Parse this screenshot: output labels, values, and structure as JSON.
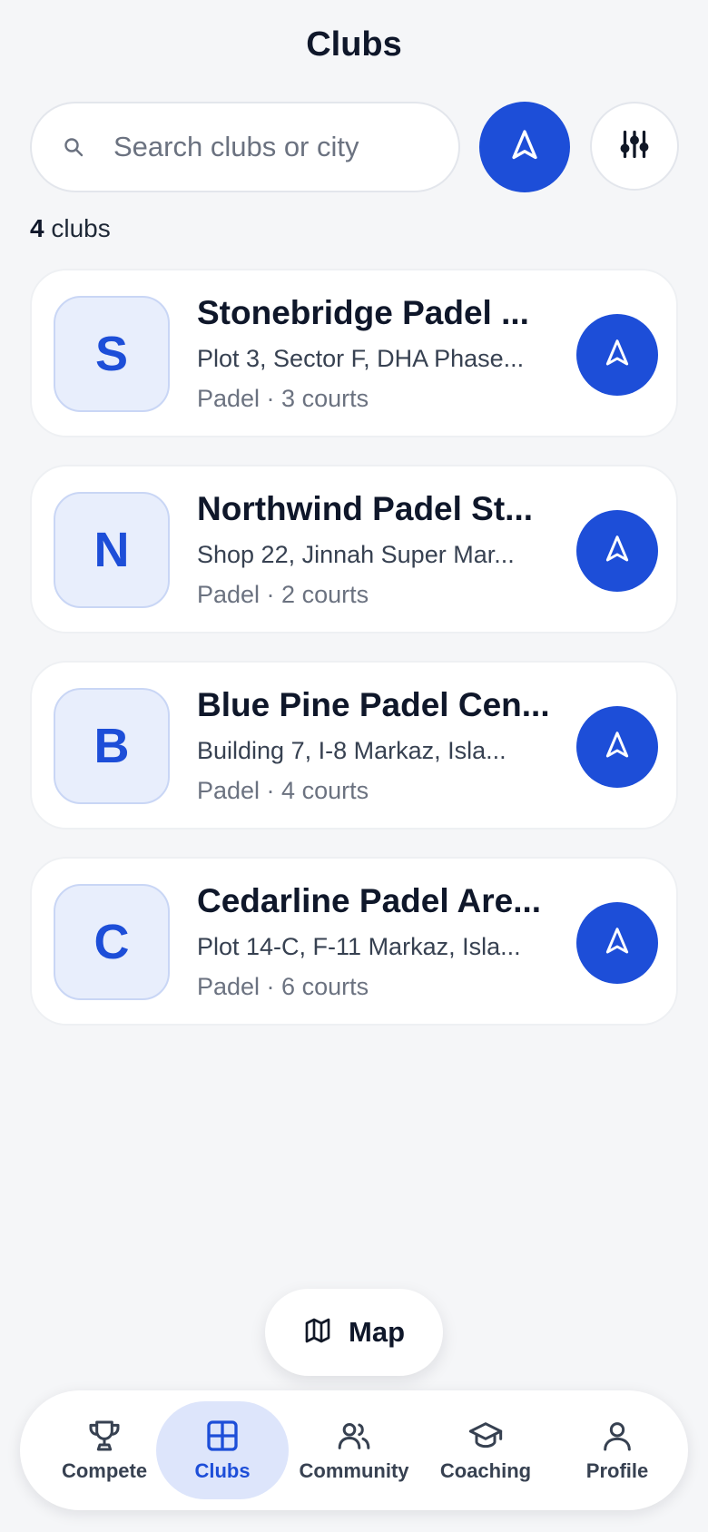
{
  "header": {
    "title": "Clubs"
  },
  "search": {
    "placeholder": "Search clubs or city"
  },
  "summary": {
    "count": "4",
    "unit": "clubs"
  },
  "clubs": [
    {
      "initial": "S",
      "name": "Stonebridge Padel ...",
      "address": "Plot 3, Sector F, DHA Phase...",
      "meta": "Padel · 3 courts"
    },
    {
      "initial": "N",
      "name": "Northwind Padel St...",
      "address": "Shop 22, Jinnah Super Mar...",
      "meta": "Padel · 2 courts"
    },
    {
      "initial": "B",
      "name": "Blue Pine Padel Cen...",
      "address": "Building 7, I-8 Markaz, Isla...",
      "meta": "Padel · 4 courts"
    },
    {
      "initial": "C",
      "name": "Cedarline Padel Are...",
      "address": "Plot 14-C, F-11 Markaz, Isla...",
      "meta": "Padel · 6 courts"
    }
  ],
  "map_button": {
    "label": "Map",
    "icon": "map-icon"
  },
  "tabs": [
    {
      "label": "Compete",
      "icon": "trophy-icon",
      "active": false
    },
    {
      "label": "Clubs",
      "icon": "grid-icon",
      "active": true
    },
    {
      "label": "Community",
      "icon": "users-icon",
      "active": false
    },
    {
      "label": "Coaching",
      "icon": "graduation-cap-icon",
      "active": false
    },
    {
      "label": "Profile",
      "icon": "user-icon",
      "active": false
    }
  ],
  "colors": {
    "accent": "#1d4ed8",
    "background": "#f5f6f8",
    "card": "#ffffff",
    "active_tab": "#dde5fb"
  }
}
